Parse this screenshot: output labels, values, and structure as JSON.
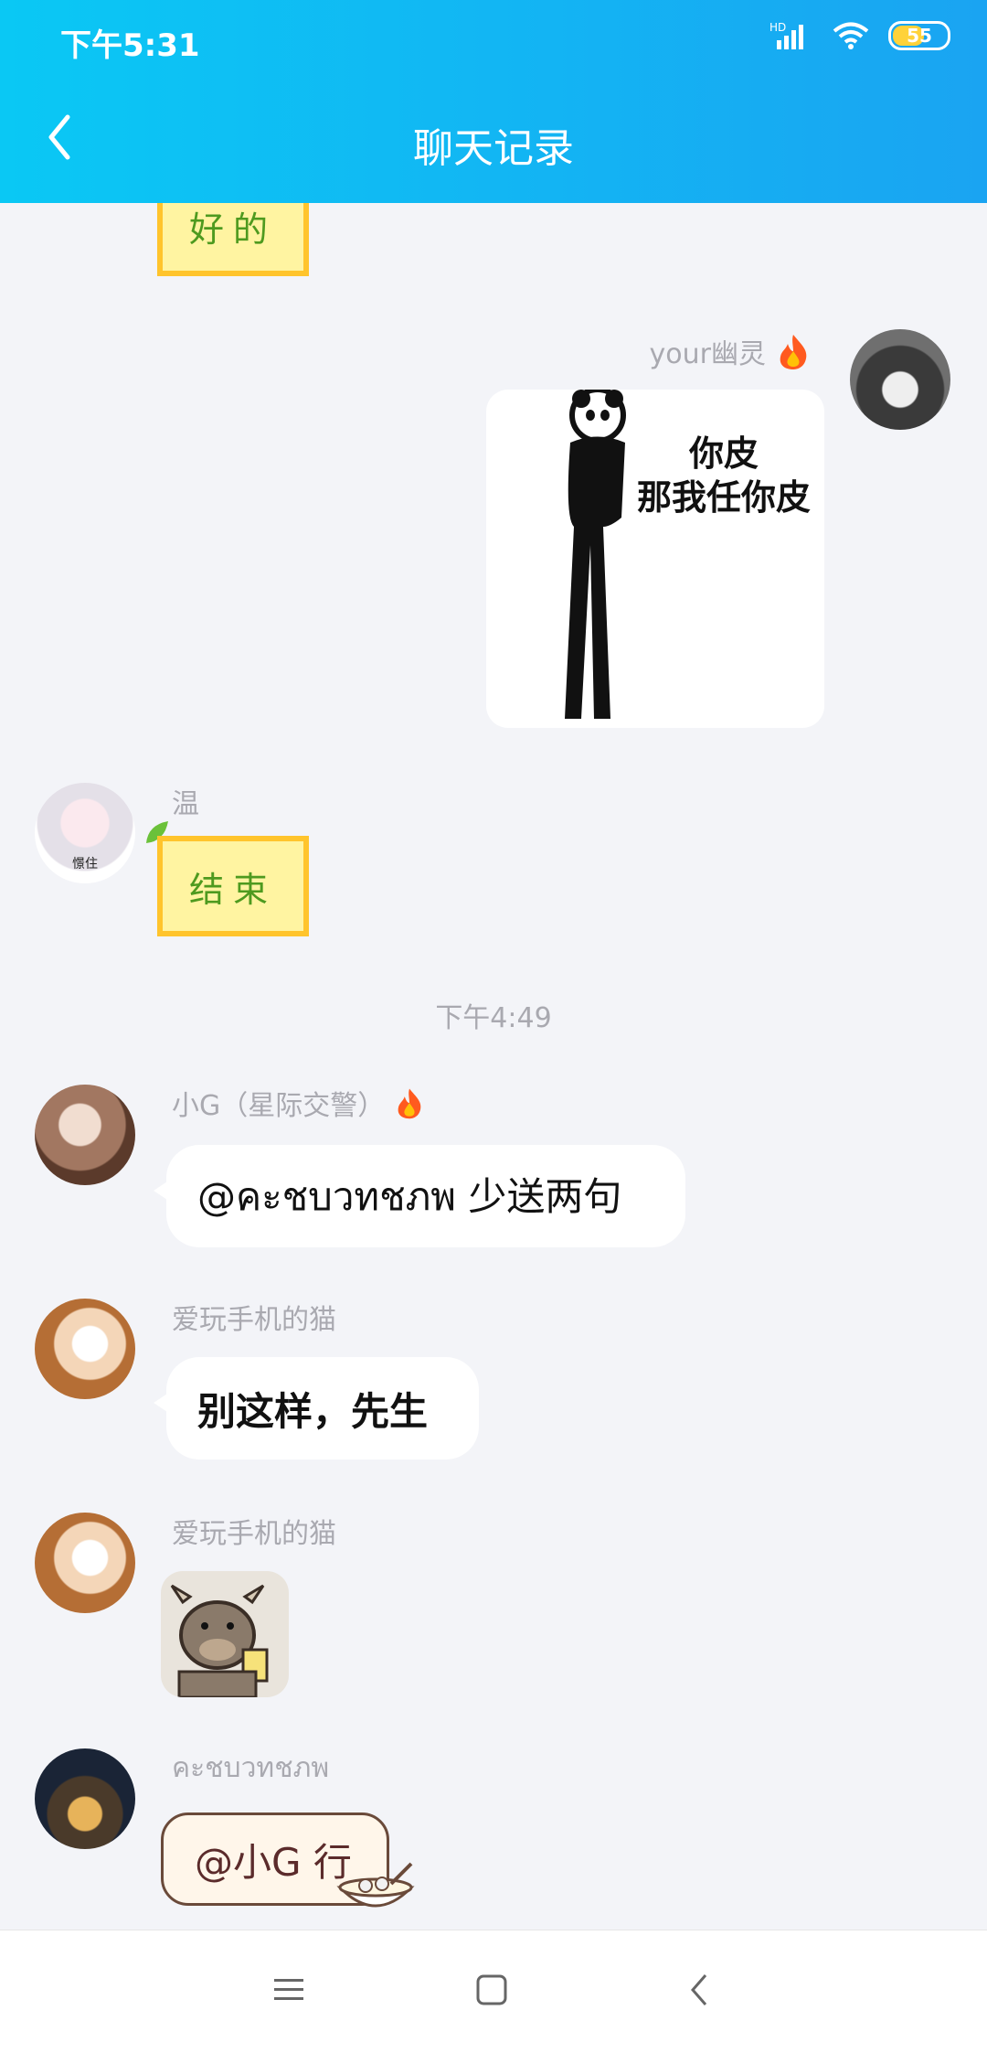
{
  "status_bar": {
    "time": "下午5:31",
    "network": "HD",
    "battery": "55"
  },
  "header": {
    "title": "聊天记录"
  },
  "messages": [
    {
      "sticker_text": "好的"
    },
    {
      "sender": "your幽灵",
      "sticker_line1": "你皮",
      "sticker_line2": "那我任你皮"
    },
    {
      "sender": "温",
      "sticker_text": "结束",
      "avatar_caption": "憬住"
    },
    {
      "time": "下午4:49"
    },
    {
      "sender": "小G（星际交警）",
      "text": "@คะชบวทชภพ 少送两句"
    },
    {
      "sender": "爱玩手机的猫",
      "text": "别这样，先生"
    },
    {
      "sender": "爱玩手机的猫",
      "sticker": "cow-sticker"
    },
    {
      "sender": "คะชบวทชภพ",
      "text": "@小G 行"
    }
  ],
  "colors": {
    "header_start": "#0ac8f4",
    "header_end": "#1aa4f2",
    "background": "#f3f4f8",
    "name_gray": "#a9a9b0"
  }
}
